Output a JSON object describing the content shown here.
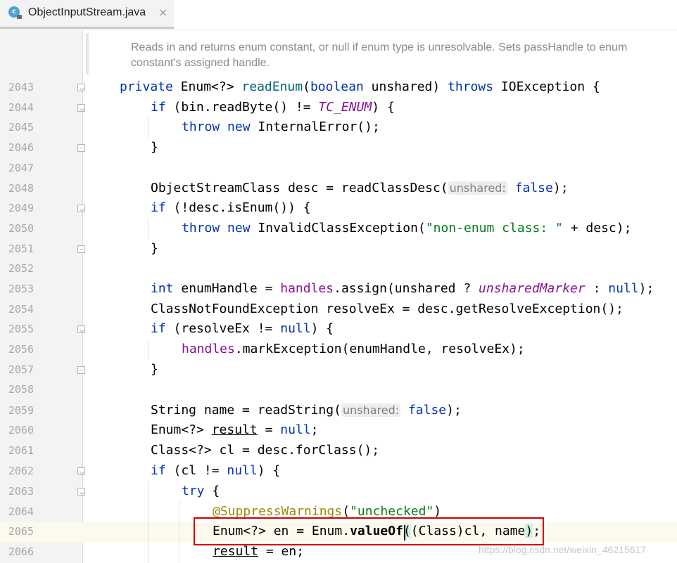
{
  "tab": {
    "title": "ObjectInputStream.java",
    "icon_letter": "c",
    "close": "×"
  },
  "doc_comment": "Reads in and returns enum constant, or null if enum type is unresolvable. Sets passHandle to enum constant's assigned handle.",
  "line_numbers": [
    "2043",
    "2044",
    "2045",
    "2046",
    "2047",
    "2048",
    "2049",
    "2050",
    "2051",
    "2052",
    "2053",
    "2054",
    "2055",
    "2056",
    "2057",
    "2058",
    "2059",
    "2060",
    "2061",
    "2062",
    "2063",
    "2064",
    "2065",
    "2066"
  ],
  "lines": {
    "l2043": {
      "a": "private ",
      "b": "Enum<?> ",
      "c": "readEnum",
      "d": "(",
      "e": "boolean ",
      "f": "unshared) ",
      "g": "throws ",
      "h": "IOException {"
    },
    "l2044": {
      "a": "if ",
      "b": "(bin.readByte() != ",
      "c": "TC_ENUM",
      "d": ") {"
    },
    "l2045": {
      "a": "throw ",
      "b": "new ",
      "c": "InternalError();"
    },
    "l2046": {
      "a": "}"
    },
    "l2048": {
      "a": "ObjectStreamClass desc = readClassDesc(",
      "hint": "unshared:",
      "b": " false",
      "c": ");"
    },
    "l2049": {
      "a": "if ",
      "b": "(!desc.isEnum()) {"
    },
    "l2050": {
      "a": "throw ",
      "b": "new ",
      "c": "InvalidClassException(",
      "d": "\"non-enum class: \"",
      "e": " + desc);"
    },
    "l2051": {
      "a": "}"
    },
    "l2053": {
      "a": "int ",
      "b": "enumHandle = ",
      "c": "handles",
      "d": ".assign(unshared ? ",
      "e": "unsharedMarker",
      "f": " : ",
      "g": "null",
      "h": ");"
    },
    "l2054": {
      "a": "ClassNotFoundException resolveEx = desc.getResolveException();"
    },
    "l2055": {
      "a": "if ",
      "b": "(resolveEx != ",
      "c": "null",
      "d": ") {"
    },
    "l2056": {
      "a": "handles",
      "b": ".markException(enumHandle, resolveEx);"
    },
    "l2057": {
      "a": "}"
    },
    "l2059": {
      "a": "String name = readString(",
      "hint": "unshared:",
      "b": " false",
      "c": ");"
    },
    "l2060": {
      "a": "Enum<?> ",
      "b": "result",
      "c": " = ",
      "d": "null",
      "e": ";"
    },
    "l2061": {
      "a": "Class<?> cl = desc.forClass();"
    },
    "l2062": {
      "a": "if ",
      "b": "(cl != ",
      "c": "null",
      "d": ") {"
    },
    "l2063": {
      "a": "try ",
      "b": "{"
    },
    "l2064": {
      "a": "@SuppressWarnings",
      "b": "(",
      "c": "\"unchecked\"",
      "d": ")"
    },
    "l2065": {
      "a": "Enum<?> en = Enum.",
      "b": "valueOf",
      "c": "(",
      "d": "(Class)cl, name",
      "e": ")",
      "f": ";"
    },
    "l2066": {
      "a": "result",
      "b": " = en;"
    }
  },
  "watermark": "https://blog.csdn.net/weixin_46215617",
  "colors": {
    "keyword": "#0033b3",
    "string": "#067d17",
    "field": "#871094",
    "annotation": "#9e880d",
    "highlight_box": "#d40000"
  }
}
